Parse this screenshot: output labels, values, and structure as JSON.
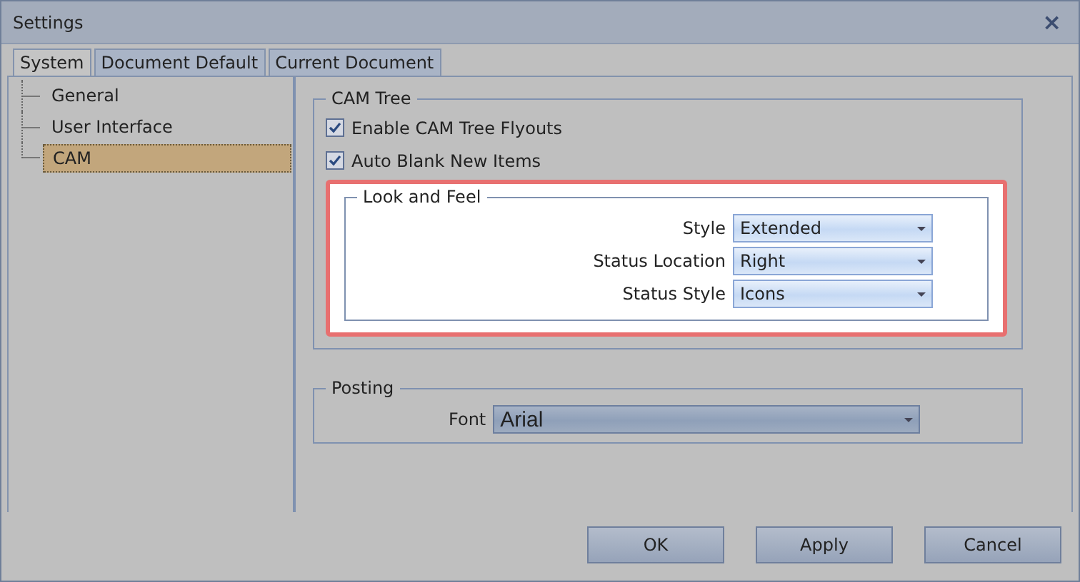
{
  "window": {
    "title": "Settings",
    "close": "×"
  },
  "tabs": [
    {
      "label": "System",
      "selected": true
    },
    {
      "label": "Document Default",
      "selected": false
    },
    {
      "label": "Current Document",
      "selected": false
    }
  ],
  "sidebar": {
    "items": [
      {
        "label": "General",
        "selected": false
      },
      {
        "label": "User Interface",
        "selected": false
      },
      {
        "label": "CAM",
        "selected": true
      }
    ]
  },
  "cam_tree": {
    "title": "CAM Tree",
    "options": [
      {
        "label": "Enable CAM Tree Flyouts",
        "checked": true
      },
      {
        "label": "Auto Blank New Items",
        "checked": true
      }
    ],
    "look_and_feel": {
      "title": "Look and Feel",
      "fields": [
        {
          "label": "Style",
          "value": "Extended"
        },
        {
          "label": "Status Location",
          "value": "Right"
        },
        {
          "label": "Status Style",
          "value": "Icons"
        }
      ]
    }
  },
  "posting": {
    "title": "Posting",
    "fields": [
      {
        "label": "Font",
        "value": "Arial"
      }
    ]
  },
  "buttons": [
    "OK",
    "Apply",
    "Cancel"
  ]
}
